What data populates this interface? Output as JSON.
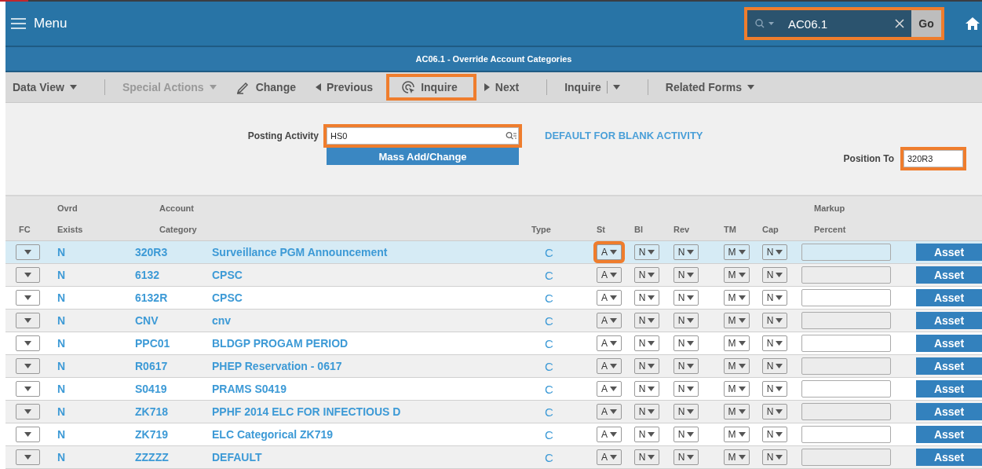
{
  "header": {
    "menu_label": "Menu",
    "search": {
      "value": "AC06.1",
      "go_label": "Go",
      "highlighted": true
    }
  },
  "form_title": "AC06.1 - Override Account Categories",
  "toolbar": [
    {
      "kind": "dropdown",
      "label": "Data View",
      "disabled": false,
      "highlighted": false
    },
    {
      "kind": "separator"
    },
    {
      "kind": "dropdown",
      "label": "Special Actions",
      "disabled": true,
      "highlighted": false
    },
    {
      "kind": "change",
      "label": "Change",
      "disabled": false,
      "highlighted": false
    },
    {
      "kind": "previous",
      "label": "Previous",
      "disabled": false,
      "highlighted": false
    },
    {
      "kind": "inquire",
      "label": "Inquire",
      "disabled": false,
      "highlighted": true
    },
    {
      "kind": "next",
      "label": "Next",
      "disabled": false,
      "highlighted": false
    },
    {
      "kind": "separator"
    },
    {
      "kind": "split",
      "label": "Inquire",
      "disabled": false,
      "highlighted": false
    },
    {
      "kind": "separator"
    },
    {
      "kind": "dropdown",
      "label": "Related Forms",
      "disabled": false,
      "highlighted": false
    }
  ],
  "form": {
    "posting_activity": {
      "label": "Posting Activity",
      "value": "HS0",
      "highlighted": true
    },
    "mass_button": "Mass Add/Change",
    "activity_description": "DEFAULT FOR BLANK ACTIVITY",
    "position_to": {
      "label": "Position To",
      "value": "320R3",
      "highlighted": true
    }
  },
  "table": {
    "columns": [
      [
        "",
        "FC"
      ],
      [
        "Ovrd",
        "Exists"
      ],
      [
        "Account",
        "Category"
      ],
      [
        "",
        ""
      ],
      [
        "",
        "Type"
      ],
      [
        "",
        "St"
      ],
      [
        "",
        "Bl"
      ],
      [
        "",
        "Rev"
      ],
      [
        "",
        "TM"
      ],
      [
        "",
        "Cap"
      ],
      [
        "Markup",
        "Percent"
      ],
      [
        "",
        ""
      ]
    ],
    "rows": [
      {
        "selected": true,
        "ovrd": "N",
        "code": "320R3",
        "description": "Surveillance PGM Announcement",
        "type": "C",
        "st": "A",
        "st_highlighted": true,
        "bl": "N",
        "rev": "N",
        "tm": "M",
        "cap": "N",
        "button": "Asset"
      },
      {
        "selected": false,
        "ovrd": "N",
        "code": "6132",
        "description": "CPSC",
        "type": "C",
        "st": "A",
        "st_highlighted": false,
        "bl": "N",
        "rev": "N",
        "tm": "M",
        "cap": "N",
        "button": "Asset"
      },
      {
        "selected": false,
        "ovrd": "N",
        "code": "6132R",
        "description": "CPSC",
        "type": "C",
        "st": "A",
        "st_highlighted": false,
        "bl": "N",
        "rev": "N",
        "tm": "M",
        "cap": "N",
        "button": "Asset"
      },
      {
        "selected": false,
        "ovrd": "N",
        "code": "CNV",
        "description": "cnv",
        "type": "C",
        "st": "A",
        "st_highlighted": false,
        "bl": "N",
        "rev": "N",
        "tm": "M",
        "cap": "N",
        "button": "Asset"
      },
      {
        "selected": false,
        "ovrd": "N",
        "code": "PPC01",
        "description": "BLDGP PROGAM PERIOD",
        "type": "C",
        "st": "A",
        "st_highlighted": false,
        "bl": "N",
        "rev": "N",
        "tm": "M",
        "cap": "N",
        "button": "Asset"
      },
      {
        "selected": false,
        "ovrd": "N",
        "code": "R0617",
        "description": "PHEP Reservation - 0617",
        "type": "C",
        "st": "A",
        "st_highlighted": false,
        "bl": "N",
        "rev": "N",
        "tm": "M",
        "cap": "N",
        "button": "Asset"
      },
      {
        "selected": false,
        "ovrd": "N",
        "code": "S0419",
        "description": "PRAMS S0419",
        "type": "C",
        "st": "A",
        "st_highlighted": false,
        "bl": "N",
        "rev": "N",
        "tm": "M",
        "cap": "N",
        "button": "Asset"
      },
      {
        "selected": false,
        "ovrd": "N",
        "code": "ZK718",
        "description": "PPHF 2014 ELC FOR INFECTIOUS D",
        "type": "C",
        "st": "A",
        "st_highlighted": false,
        "bl": "N",
        "rev": "N",
        "tm": "M",
        "cap": "N",
        "button": "Asset"
      },
      {
        "selected": false,
        "ovrd": "N",
        "code": "ZK719",
        "description": "ELC Categorical ZK719",
        "type": "C",
        "st": "A",
        "st_highlighted": false,
        "bl": "N",
        "rev": "N",
        "tm": "M",
        "cap": "N",
        "button": "Asset"
      },
      {
        "selected": false,
        "ovrd": "N",
        "code": "ZZZZZ",
        "description": "DEFAULT",
        "type": "C",
        "st": "A",
        "st_highlighted": false,
        "bl": "N",
        "rev": "N",
        "tm": "M",
        "cap": "N",
        "button": "Asset"
      }
    ]
  }
}
